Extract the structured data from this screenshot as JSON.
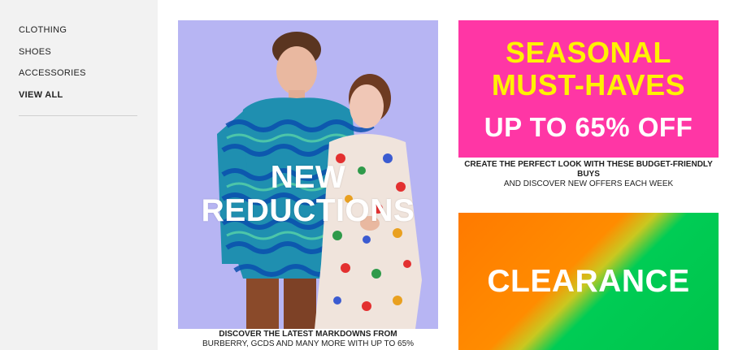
{
  "sidebar": {
    "items": [
      {
        "label": "CLOTHING"
      },
      {
        "label": "SHOES"
      },
      {
        "label": "ACCESSORIES"
      },
      {
        "label": "VIEW ALL"
      }
    ]
  },
  "promos": {
    "new_reductions": {
      "headline_line1": "NEW",
      "headline_line2": "REDUCTIONS",
      "caption_bold": "DISCOVER THE LATEST MARKDOWNS FROM",
      "caption_rest": "BURBERRY, GCDS AND MANY MORE WITH UP TO 65%"
    },
    "seasonal": {
      "line1": "SEASONAL",
      "line2": "MUST-HAVES",
      "line3": "UP TO 65% OFF",
      "caption_bold": "CREATE THE PERFECT LOOK WITH THESE BUDGET-FRIENDLY BUYS",
      "caption_rest": "AND DISCOVER NEW OFFERS EACH WEEK"
    },
    "clearance": {
      "label": "CLEARANCE"
    }
  },
  "colors": {
    "sidebar_bg": "#f2f2f2",
    "pink": "#ff36a5",
    "yellow": "#fff200",
    "orange": "#ff8c00",
    "green": "#00c44a",
    "photo_bg": "#b7b5f3"
  }
}
